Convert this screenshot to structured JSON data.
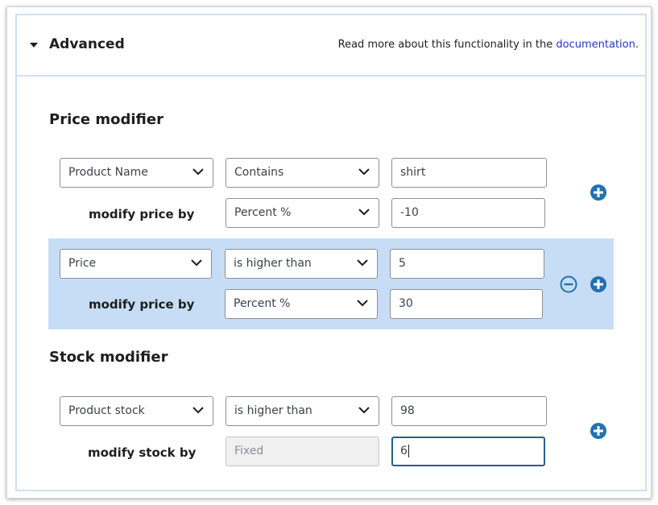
{
  "header": {
    "title": "Advanced",
    "note_prefix": "Read more about this functionality in the ",
    "note_link": "documentation",
    "note_suffix": "."
  },
  "price_section": {
    "title": "Price modifier",
    "rules": [
      {
        "field": "Product Name",
        "condition": "Contains",
        "value": "shirt",
        "modify_label": "modify price by",
        "modify_type": "Percent %",
        "modify_value": "-10"
      },
      {
        "field": "Price",
        "condition": "is higher than",
        "value": "5",
        "modify_label": "modify price by",
        "modify_type": "Percent %",
        "modify_value": "30"
      }
    ]
  },
  "stock_section": {
    "title": "Stock modifier",
    "rules": [
      {
        "field": "Product stock",
        "condition": "is higher than",
        "value": "98",
        "modify_label": "modify stock by",
        "modify_type": "Fixed",
        "modify_value": "6"
      }
    ]
  },
  "icons": {
    "add": "plus-circle-icon",
    "remove": "minus-circle-icon",
    "dropdown": "chevron-down-icon",
    "collapse": "caret-down-icon"
  },
  "colors": {
    "accent": "#2271b1",
    "highlight": "#c7ddf5",
    "link": "#2238c8"
  }
}
